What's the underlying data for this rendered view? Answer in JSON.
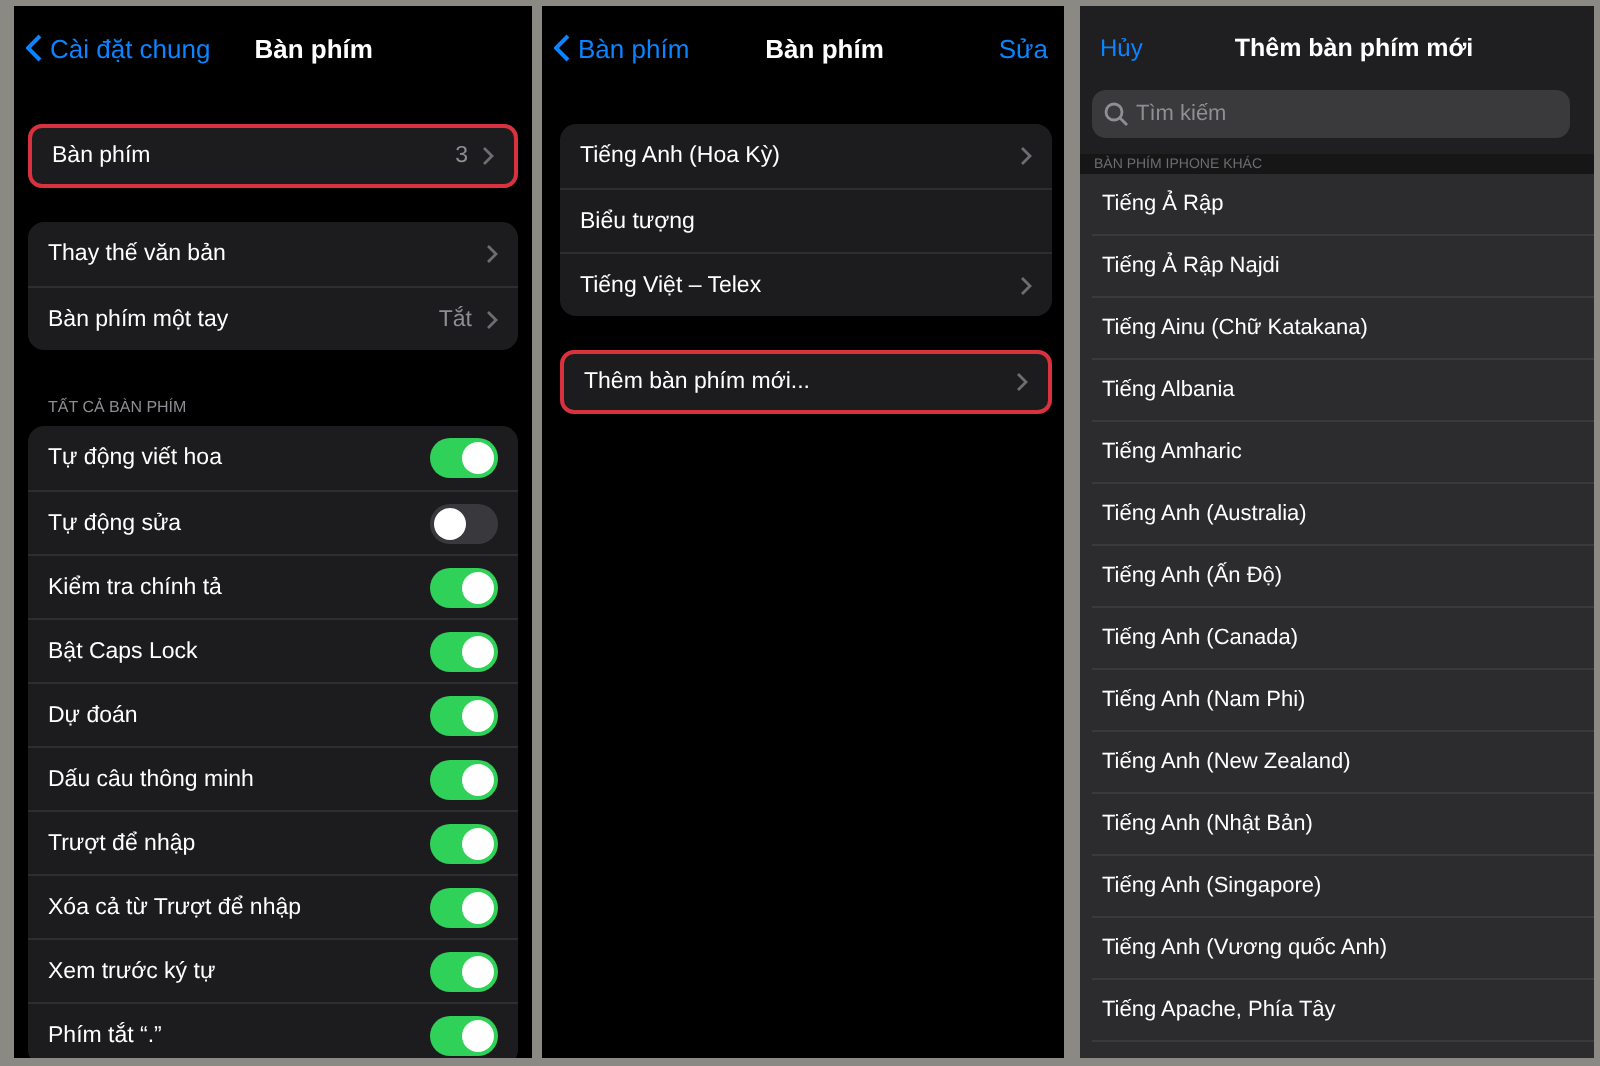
{
  "screens": [
    {
      "kind": "settings",
      "nav": {
        "back": "Cài đặt chung",
        "title": "Bàn phím"
      },
      "groups": [
        {
          "items": [
            {
              "kind": "link",
              "label": "Bàn phím",
              "value": "3",
              "chevron": true,
              "highlighted": true
            }
          ]
        },
        {
          "items": [
            {
              "kind": "link",
              "label": "Thay thế văn bản",
              "chevron": true,
              "highlighted": false
            },
            {
              "kind": "link",
              "label": "Bàn phím một tay",
              "value": "Tắt",
              "chevron": true,
              "highlighted": false
            }
          ]
        },
        {
          "header": "TẤT CẢ BÀN PHÍM",
          "items": [
            {
              "kind": "toggle",
              "label": "Tự động viết hoa",
              "on": true
            },
            {
              "kind": "toggle",
              "label": "Tự động sửa",
              "on": false
            },
            {
              "kind": "toggle",
              "label": "Kiểm tra chính tả",
              "on": true
            },
            {
              "kind": "toggle",
              "label": "Bật Caps Lock",
              "on": true
            },
            {
              "kind": "toggle",
              "label": "Dự đoán",
              "on": true
            },
            {
              "kind": "toggle",
              "label": "Dấu câu thông minh",
              "on": true
            },
            {
              "kind": "toggle",
              "label": "Trượt để nhập",
              "on": true
            },
            {
              "kind": "toggle",
              "label": "Xóa cả từ Trượt để nhập",
              "on": true
            },
            {
              "kind": "toggle",
              "label": "Xem trước ký tự",
              "on": true
            },
            {
              "kind": "toggle",
              "label": "Phím tắt “.”",
              "on": true
            }
          ]
        }
      ]
    },
    {
      "kind": "settings",
      "nav": {
        "back": "Bàn phím",
        "title": "Bàn phím",
        "action": "Sửa"
      },
      "groups": [
        {
          "items": [
            {
              "kind": "link",
              "label": "Tiếng Anh (Hoa Kỳ)",
              "chevron": true,
              "highlighted": false
            },
            {
              "kind": "link",
              "label": "Biểu tượng",
              "chevron": false,
              "highlighted": false
            },
            {
              "kind": "link",
              "label": "Tiếng Việt – Telex",
              "chevron": true,
              "highlighted": false
            }
          ]
        },
        {
          "items": [
            {
              "kind": "link",
              "label": "Thêm bàn phím mới...",
              "chevron": true,
              "highlighted": true
            }
          ]
        }
      ]
    },
    {
      "kind": "picker",
      "nav": {
        "cancel": "Hủy",
        "title": "Thêm bàn phím mới"
      },
      "search": {
        "placeholder": "Tìm kiếm"
      },
      "section": "BÀN PHÍM IPHONE KHÁC",
      "items": [
        "Tiếng Ả Rập",
        "Tiếng Ả Rập Najdi",
        "Tiếng Ainu (Chữ Katakana)",
        "Tiếng Albania",
        "Tiếng Amharic",
        "Tiếng Anh (Australia)",
        "Tiếng Anh (Ấn Độ)",
        "Tiếng Anh (Canada)",
        "Tiếng Anh (Nam Phi)",
        "Tiếng Anh (New Zealand)",
        "Tiếng Anh (Nhật Bản)",
        "Tiếng Anh (Singapore)",
        "Tiếng Anh (Vương quốc Anh)",
        "Tiếng Apache, Phía Tây"
      ]
    }
  ]
}
